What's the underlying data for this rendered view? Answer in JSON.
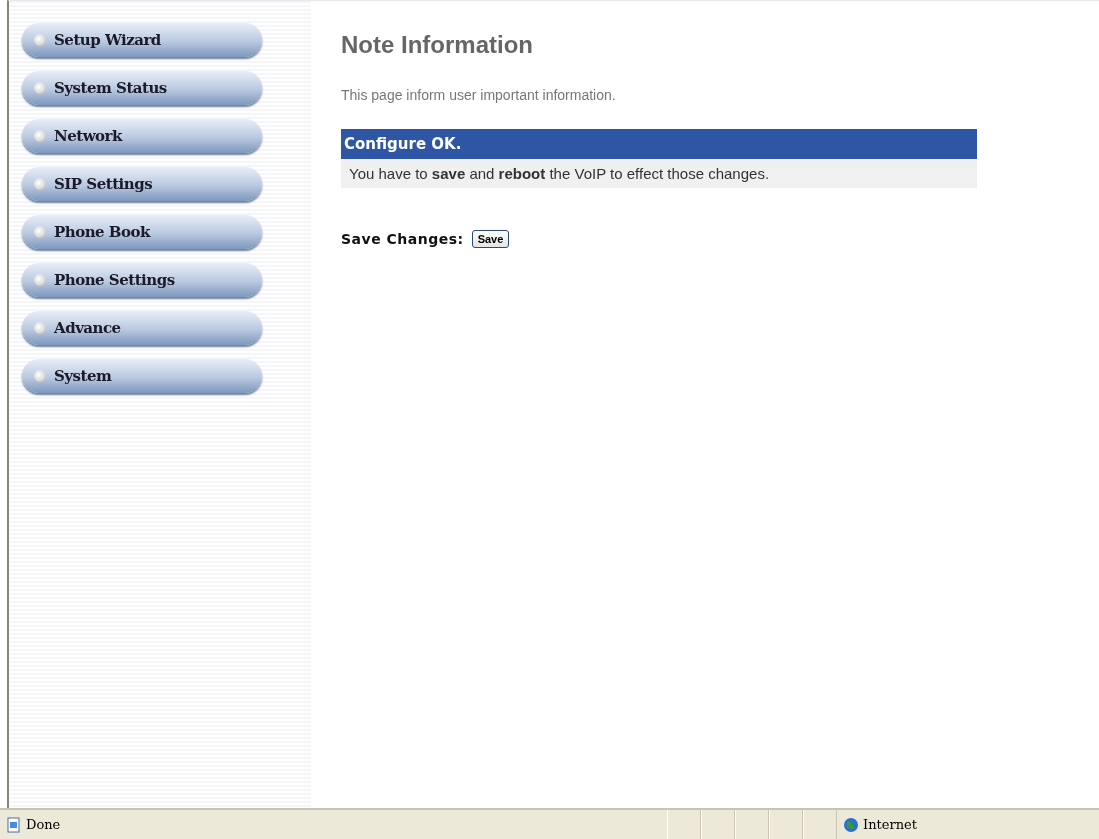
{
  "sidebar": {
    "items": [
      {
        "label": "Setup Wizard"
      },
      {
        "label": "System Status"
      },
      {
        "label": "Network"
      },
      {
        "label": "SIP Settings"
      },
      {
        "label": "Phone Book"
      },
      {
        "label": "Phone Settings"
      },
      {
        "label": "Advance"
      },
      {
        "label": "System"
      }
    ]
  },
  "main": {
    "title": "Note Information",
    "description": "This page inform user important information.",
    "notice": {
      "heading": "Configure OK.",
      "message": "You have to **save** and **reboot** the VoIP to effect those changes."
    },
    "save": {
      "label": "Save Changes:",
      "button": "Save"
    }
  },
  "status_bar": {
    "status": "Done",
    "zone": "Internet"
  }
}
